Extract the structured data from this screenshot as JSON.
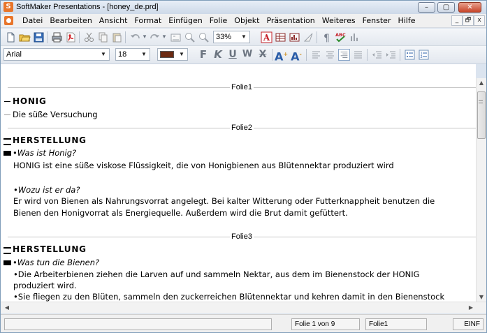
{
  "window": {
    "title": "SoftMaker Presentations - [honey_de.prd]",
    "app_icon_letter": "S",
    "buttons": [
      "minimize",
      "maximize",
      "close"
    ]
  },
  "menubar": {
    "items": [
      "Datei",
      "Bearbeiten",
      "Ansicht",
      "Format",
      "Einfügen",
      "Folie",
      "Objekt",
      "Präsentation",
      "Weiteres",
      "Fenster",
      "Hilfe"
    ],
    "mdi_buttons": [
      "_",
      "🗗",
      "x"
    ]
  },
  "toolbar": {
    "zoom": "33%"
  },
  "format_bar": {
    "font": "Arial",
    "size": "18",
    "color": "#6b2a12",
    "font_color_swatch": "#6b2a12"
  },
  "outline": {
    "slides": [
      {
        "label": "Folie1",
        "title": "HONIG",
        "subtitle": "Die süße Versuchung"
      },
      {
        "label": "Folie2",
        "title": "HERSTELLUNG",
        "lines": [
          {
            "text": "•Was ist Honig?",
            "italic": true
          },
          {
            "text": "HONIG ist eine süße viskose Flüssigkeit, die von Honigbienen aus Blütennektar produziert wird",
            "italic": false
          },
          {
            "text": "",
            "italic": false
          },
          {
            "text": "•Wozu ist er da?",
            "italic": true
          },
          {
            "text": "Er wird von Bienen als Nahrungsvorrat angelegt. Bei kalter Witterung oder Futterknappheit benutzen die",
            "italic": false
          },
          {
            "text": "Bienen den Honigvorrat als Energiequelle. Außerdem wird die Brut damit gefüttert.",
            "italic": false
          }
        ]
      },
      {
        "label": "Folie3",
        "title": "HERSTELLUNG",
        "lines": [
          {
            "text": "•Was tun die Bienen?",
            "italic": true
          },
          {
            "text": "•Die Arbeiterbienen ziehen die Larven auf und sammeln Nektar, aus dem im Bienenstock der HONIG",
            "italic": false
          },
          {
            "text": "produziert wird.",
            "italic": false
          },
          {
            "text": "•Sie fliegen zu den Blüten, sammeln den zuckerreichen Blütennektar und kehren damit in den Bienenstock",
            "italic": false
          }
        ]
      }
    ]
  },
  "statusbar": {
    "page": "Folie 1 von 9",
    "slide": "Folie1",
    "mode": "EINF"
  }
}
